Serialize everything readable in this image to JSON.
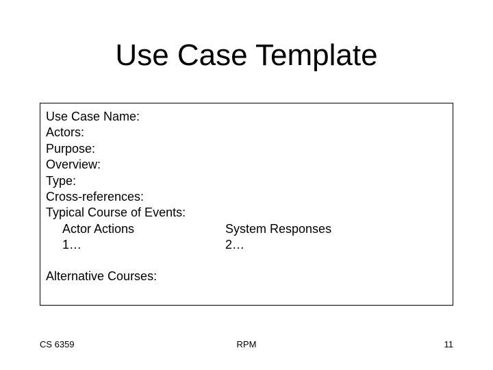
{
  "title": "Use Case Template",
  "fields": {
    "use_case_name": "Use Case Name:",
    "actors": "Actors:",
    "purpose": "Purpose:",
    "overview": "Overview:",
    "type": "Type:",
    "cross_references": "Cross-references:",
    "typical_course": "Typical Course of Events:",
    "actor_actions": "Actor Actions",
    "actor_step": "1…",
    "system_responses": "System Responses",
    "system_step": "2…",
    "alternative_courses": "Alternative Courses:"
  },
  "footer": {
    "left": "CS 6359",
    "center": "RPM",
    "right": "11"
  }
}
